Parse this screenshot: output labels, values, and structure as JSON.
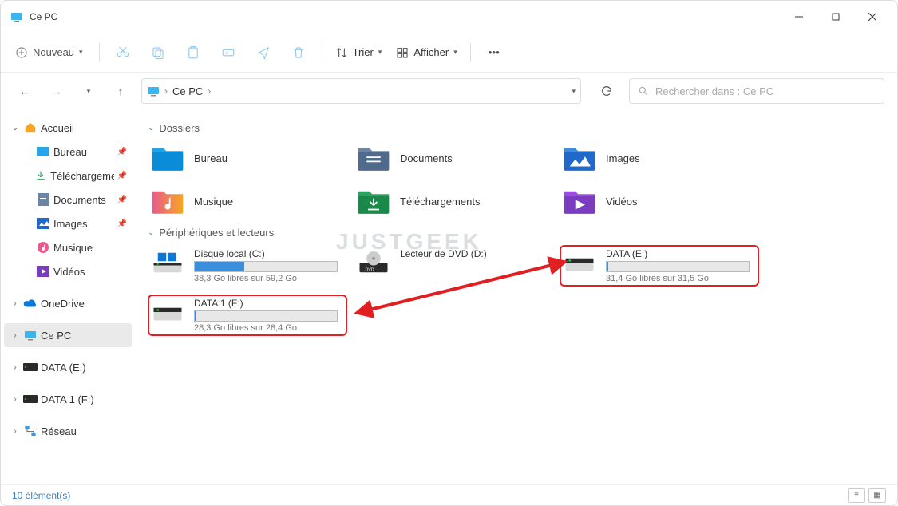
{
  "window": {
    "title": "Ce PC"
  },
  "toolbar": {
    "new_label": "Nouveau",
    "sort_label": "Trier",
    "view_label": "Afficher"
  },
  "address": {
    "path": "Ce PC",
    "search_placeholder": "Rechercher dans : Ce PC"
  },
  "sidebar": {
    "home": "Accueil",
    "items": [
      {
        "label": "Bureau"
      },
      {
        "label": "Téléchargement"
      },
      {
        "label": "Documents"
      },
      {
        "label": "Images"
      },
      {
        "label": "Musique"
      },
      {
        "label": "Vidéos"
      }
    ],
    "onedrive": "OneDrive",
    "this_pc": "Ce PC",
    "data_e": "DATA (E:)",
    "data_f": "DATA 1 (F:)",
    "network": "Réseau"
  },
  "sections": {
    "folders_title": "Dossiers",
    "drives_title": "Périphériques et lecteurs"
  },
  "folders": [
    {
      "label": "Bureau"
    },
    {
      "label": "Documents"
    },
    {
      "label": "Images"
    },
    {
      "label": "Musique"
    },
    {
      "label": "Téléchargements"
    },
    {
      "label": "Vidéos"
    }
  ],
  "drives": [
    {
      "label": "Disque local (C:)",
      "stat": "38,3 Go libres sur 59,2 Go",
      "fill": 35
    },
    {
      "label": "Lecteur de DVD (D:)",
      "stat": ""
    },
    {
      "label": "DATA (E:)",
      "stat": "31,4 Go libres sur 31,5 Go",
      "fill": 1
    },
    {
      "label": "DATA 1 (F:)",
      "stat": "28,3 Go libres sur 28,4 Go",
      "fill": 1
    }
  ],
  "status": {
    "count": "10 élément(s)"
  },
  "watermark": "JUSTGEEK"
}
